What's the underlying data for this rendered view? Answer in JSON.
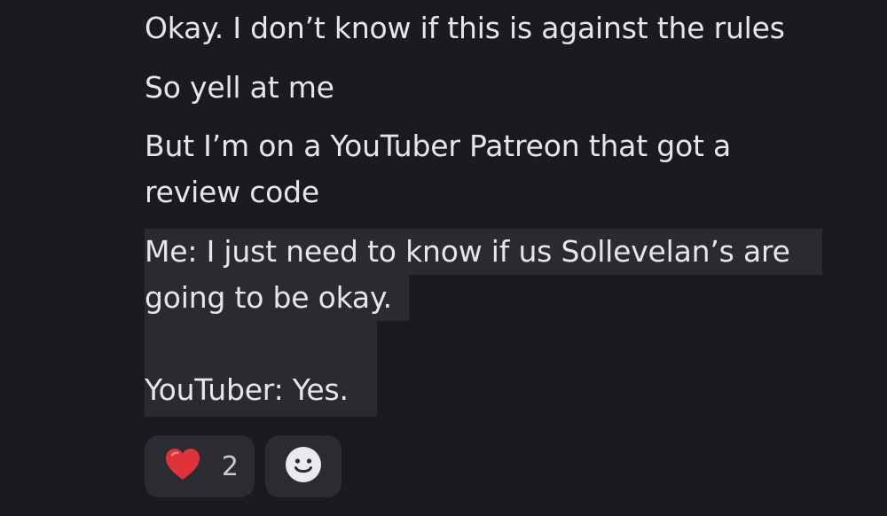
{
  "messages": [
    "Okay. I don’t know if this is against the rules",
    "So yell at me",
    "But I’m on a YouTuber Patreon that got a",
    "review code"
  ],
  "quote": {
    "line1": "Me: I just need to know if us Sollevelan’s are",
    "line2": "going to be okay.",
    "line3": "YouTuber: Yes."
  },
  "reactions": {
    "heart_icon": "heart-emoji",
    "heart_count": "2",
    "add_icon": "smiley-add-reaction"
  },
  "colors": {
    "background": "#1b1b1f",
    "text": "#e6e6ea",
    "quote_bg": "#2a2a31",
    "reaction_bg": "#2b2b31",
    "heart": "#e0323a"
  }
}
